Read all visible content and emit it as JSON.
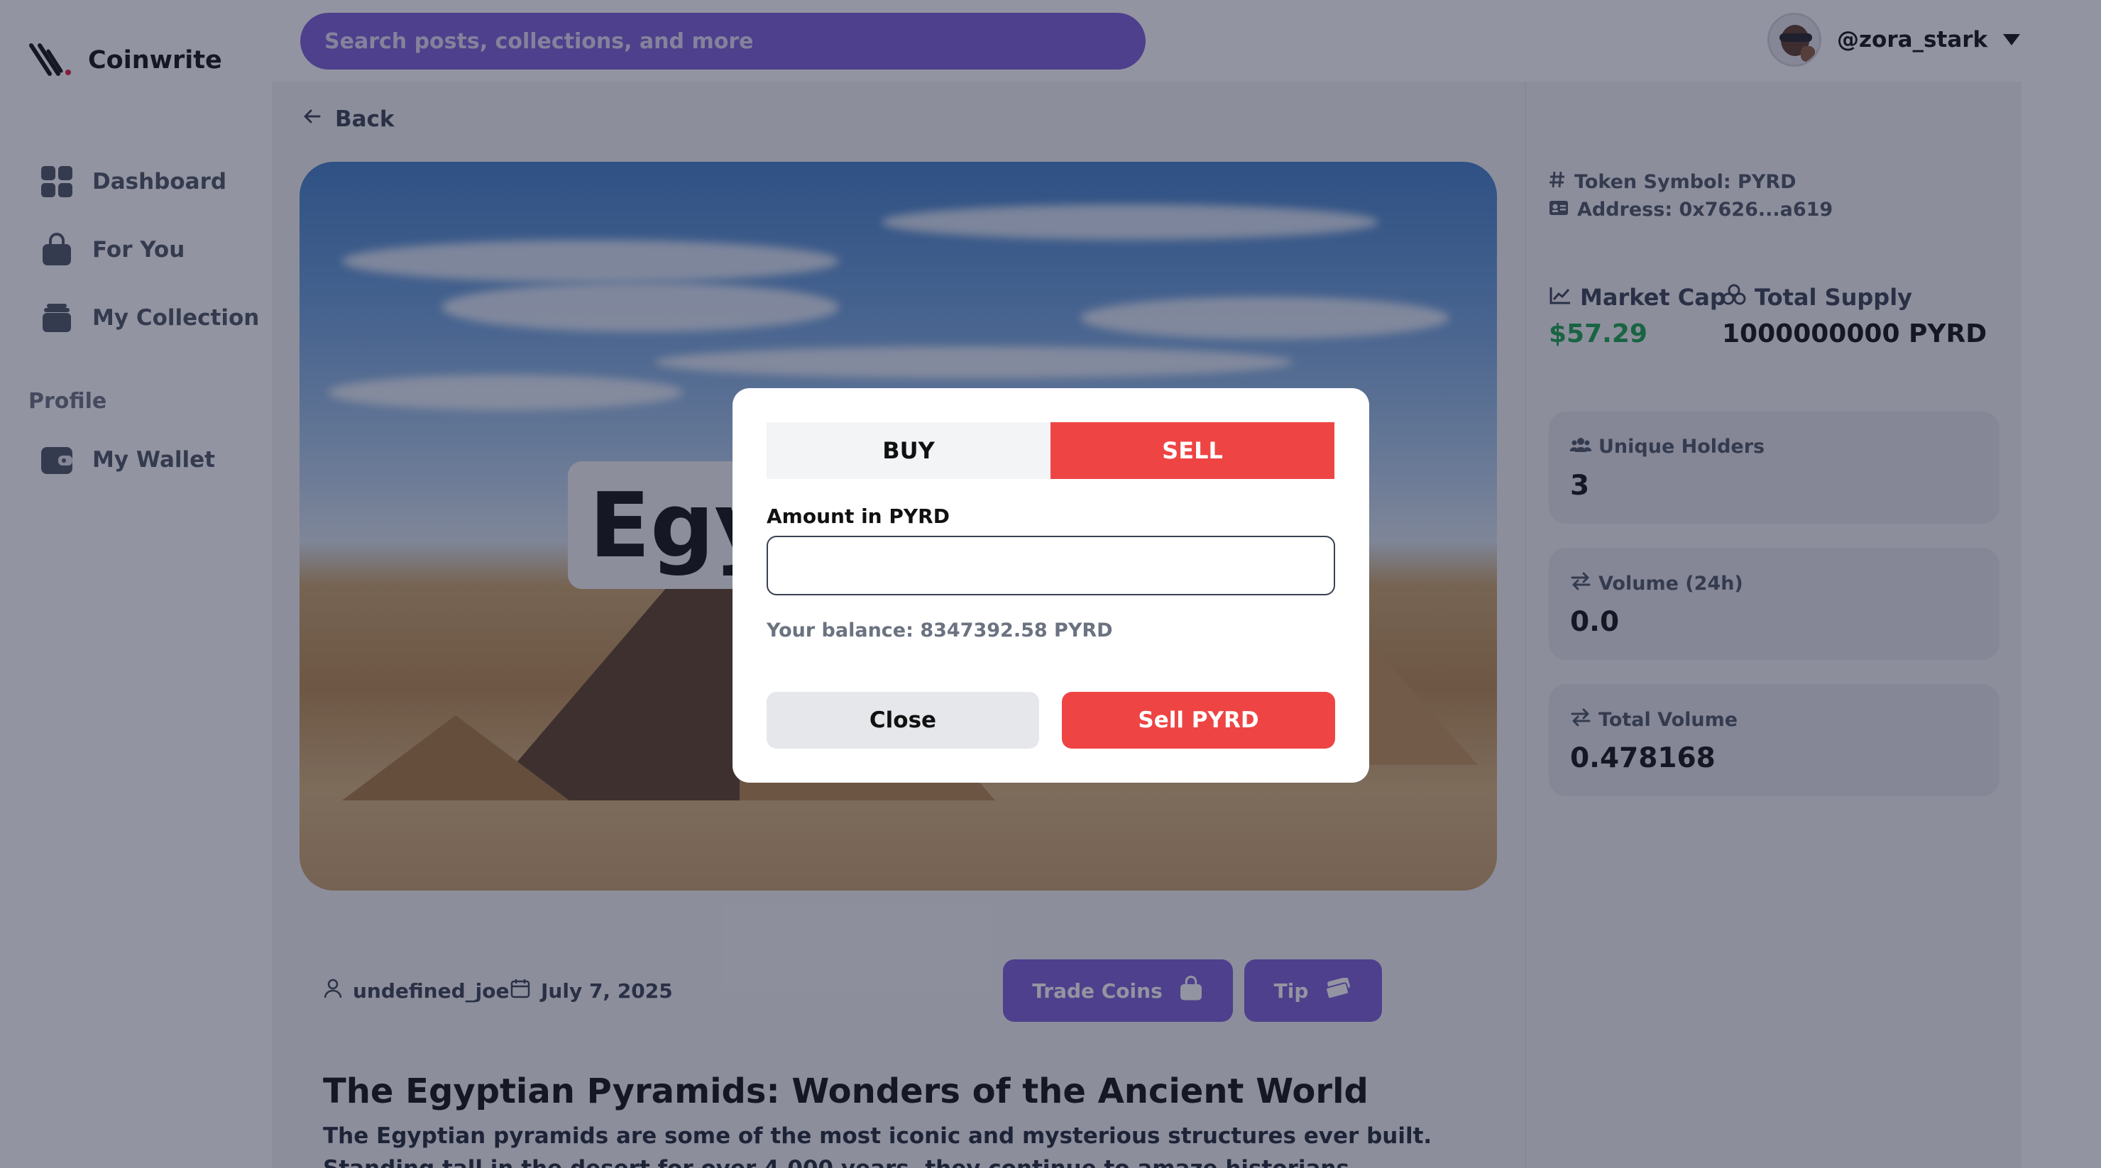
{
  "app": {
    "name": "Coinwrite"
  },
  "search": {
    "placeholder": "Search posts, collections, and more"
  },
  "user": {
    "handle": "@zora_stark"
  },
  "sidebar": {
    "items": [
      {
        "label": "Dashboard",
        "icon": "dashboard-grid-icon"
      },
      {
        "label": "For You",
        "icon": "shopping-bag-icon"
      },
      {
        "label": "My Collection",
        "icon": "collection-icon"
      }
    ],
    "section_label": "Profile",
    "profile_items": [
      {
        "label": "My Wallet",
        "icon": "wallet-icon"
      }
    ]
  },
  "main": {
    "back_label": "Back",
    "hero_title": "Egyptian Pyramids",
    "author": "undefined_joe",
    "date": "July 7, 2025",
    "trade_label": "Trade Coins",
    "tip_label": "Tip",
    "article_title": "The Egyptian Pyramids: Wonders of the Ancient World",
    "article_excerpt": "The Egyptian pyramids are some of the most iconic and mysterious structures ever built. Standing tall in the desert for over 4,000 years, they continue to amaze historians, travellers, and engineers alike."
  },
  "token": {
    "symbol_text": "Token Symbol: PYRD",
    "address_text": "Address: 0x7626...a619",
    "market_cap_label": "Market Cap",
    "market_cap_value": "$57.29",
    "total_supply_label": "Total Supply",
    "total_supply_value": "1000000000 PYRD",
    "cards": [
      {
        "label": "Unique Holders",
        "value": "3"
      },
      {
        "label": "Volume (24h)",
        "value": "0.0"
      },
      {
        "label": "Total Volume",
        "value": "0.478168"
      }
    ]
  },
  "modal": {
    "tab_buy": "BUY",
    "tab_sell": "SELL",
    "active_tab": "SELL",
    "amount_label": "Amount in PYRD",
    "amount_value": "",
    "balance_text": "Your balance: 8347392.58 PYRD",
    "close_label": "Close",
    "sell_label": "Sell PYRD"
  },
  "colors": {
    "accent_purple": "#7b5fd6",
    "sell_red": "#ef4444",
    "positive_green": "#16a34a"
  }
}
